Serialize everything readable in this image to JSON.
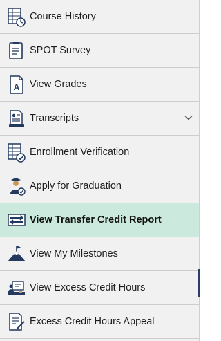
{
  "menu": {
    "items": [
      {
        "label": "Course History",
        "icon": "course-history-icon"
      },
      {
        "label": "SPOT Survey",
        "icon": "clipboard-icon"
      },
      {
        "label": "View Grades",
        "icon": "grade-document-icon"
      },
      {
        "label": "Transcripts",
        "icon": "transcript-icon",
        "expandable": true
      },
      {
        "label": "Enrollment Verification",
        "icon": "verification-icon"
      },
      {
        "label": "Apply for Graduation",
        "icon": "graduate-icon"
      },
      {
        "label": "View Transfer Credit Report",
        "icon": "transfer-icon",
        "active": true
      },
      {
        "label": "View My Milestones",
        "icon": "mountain-flag-icon"
      },
      {
        "label": "View Excess Credit Hours",
        "icon": "excess-credit-icon"
      },
      {
        "label": "Excess Credit Hours Appeal",
        "icon": "appeal-document-icon"
      }
    ]
  },
  "colors": {
    "background": "#f1f1f1",
    "active_background": "#cbe9dc",
    "icon_blue": "#23395d",
    "divider": "#cdcdcd"
  }
}
